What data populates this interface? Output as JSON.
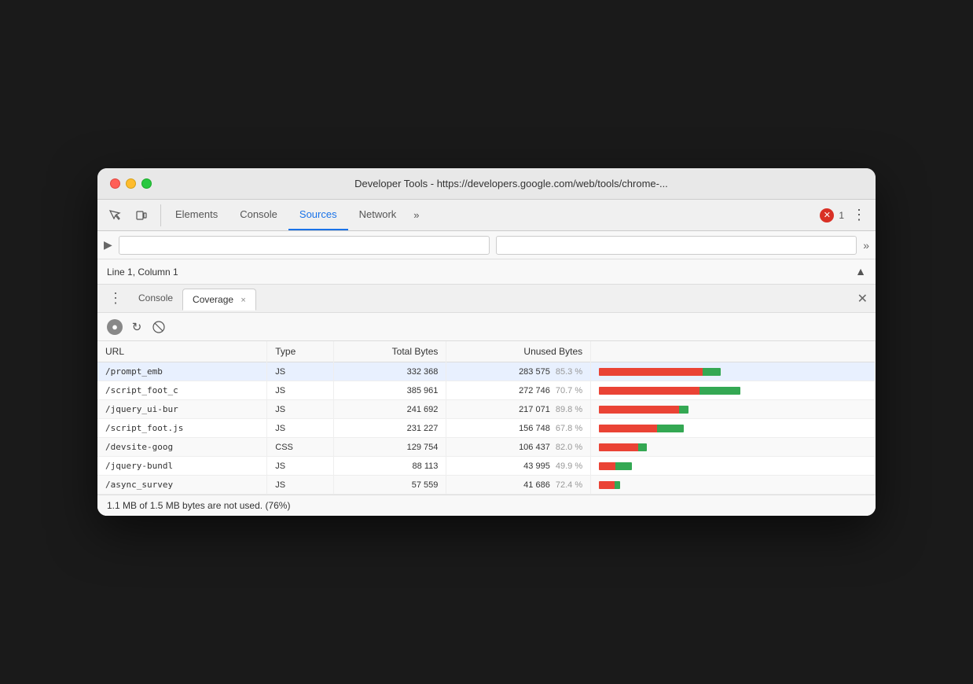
{
  "window": {
    "title": "Developer Tools - https://developers.google.com/web/tools/chrome-..."
  },
  "traffic_lights": {
    "red": "close",
    "yellow": "minimize",
    "green": "maximize"
  },
  "devtools": {
    "tabs": [
      {
        "label": "Elements",
        "active": false
      },
      {
        "label": "Console",
        "active": false
      },
      {
        "label": "Sources",
        "active": true
      },
      {
        "label": "Network",
        "active": false
      }
    ],
    "more_tabs": "»",
    "error_count": "1",
    "more_options": "⋮"
  },
  "subbar": {
    "icon": "▶",
    "more": "»"
  },
  "status": {
    "text": "Line 1, Column 1",
    "icon": "▲"
  },
  "panel": {
    "dots_menu": "⋮",
    "tabs": [
      {
        "label": "Console",
        "active": false,
        "closeable": false
      },
      {
        "label": "Coverage",
        "active": true,
        "closeable": true
      }
    ],
    "close": "✕"
  },
  "coverage": {
    "actions": {
      "record_label": "●",
      "reload_label": "↻",
      "clear_label": "🚫"
    },
    "table": {
      "headers": [
        "URL",
        "Type",
        "Total Bytes",
        "Unused Bytes",
        ""
      ],
      "rows": [
        {
          "url": "/prompt_emb",
          "type": "JS",
          "total_bytes": "332 368",
          "unused_bytes": "283 575",
          "unused_pct": "85.3 %",
          "used_pct": 14.7,
          "unused_bar_pct": 85.3
        },
        {
          "url": "/script_foot_c",
          "type": "JS",
          "total_bytes": "385 961",
          "unused_bytes": "272 746",
          "unused_pct": "70.7 %",
          "used_pct": 29.3,
          "unused_bar_pct": 70.7
        },
        {
          "url": "/jquery_ui-bur",
          "type": "JS",
          "total_bytes": "241 692",
          "unused_bytes": "217 071",
          "unused_pct": "89.8 %",
          "used_pct": 10.2,
          "unused_bar_pct": 89.8
        },
        {
          "url": "/script_foot.js",
          "type": "JS",
          "total_bytes": "231 227",
          "unused_bytes": "156 748",
          "unused_pct": "67.8 %",
          "used_pct": 32.2,
          "unused_bar_pct": 67.8
        },
        {
          "url": "/devsite-goog",
          "type": "CSS",
          "total_bytes": "129 754",
          "unused_bytes": "106 437",
          "unused_pct": "82.0 %",
          "used_pct": 18.0,
          "unused_bar_pct": 82.0
        },
        {
          "url": "/jquery-bundl",
          "type": "JS",
          "total_bytes": "88 113",
          "unused_bytes": "43 995",
          "unused_pct": "49.9 %",
          "used_pct": 50.1,
          "unused_bar_pct": 49.9
        },
        {
          "url": "/async_survey",
          "type": "JS",
          "total_bytes": "57 559",
          "unused_bytes": "41 686",
          "unused_pct": "72.4 %",
          "used_pct": 27.6,
          "unused_bar_pct": 72.4
        }
      ]
    },
    "footer": "1.1 MB of 1.5 MB bytes are not used. (76%)"
  }
}
